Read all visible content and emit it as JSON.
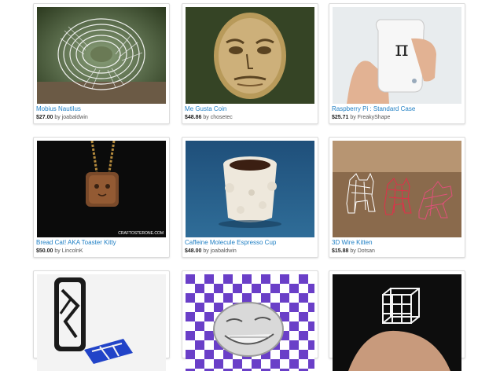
{
  "items": [
    {
      "title": "Mobius Nautilus",
      "price": "$27.00",
      "by": "by",
      "author": "joabaldwin"
    },
    {
      "title": "Me Gusta Coin",
      "price": "$48.86",
      "by": "by",
      "author": "chosetec"
    },
    {
      "title": "Raspberry Pi : Standard Case",
      "price": "$25.71",
      "by": "by",
      "author": "FreakyShape"
    },
    {
      "title": "Bread Cat! AKA Toaster Kitty",
      "price": "$50.00",
      "by": "by",
      "author": "LincolnK"
    },
    {
      "title": "Caffeine Molecule Espresso Cup",
      "price": "$48.00",
      "by": "by",
      "author": "joabaldwin"
    },
    {
      "title": "3D Wire Kitten",
      "price": "$15.88",
      "by": "by",
      "author": "Dotsan"
    },
    {
      "title": "",
      "price": "",
      "by": "",
      "author": ""
    },
    {
      "title": "",
      "price": "",
      "by": "",
      "author": ""
    },
    {
      "title": "",
      "price": "",
      "by": "",
      "author": ""
    }
  ],
  "images": {
    "raspberry_logo": "π",
    "watermark": "CRAFTOSTERONE.COM"
  }
}
